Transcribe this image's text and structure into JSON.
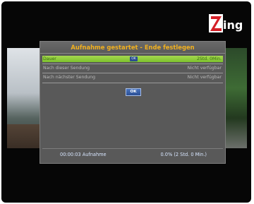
{
  "brand": {
    "logo_text": "Zing",
    "logo_color": "#d41f27"
  },
  "dialog": {
    "title": "Aufnahme gestartet - Ende festlegen",
    "rows": [
      {
        "label": "Dauer",
        "value": "2Std. 0Min.",
        "selected": true,
        "chip": "OK"
      },
      {
        "label": "Nach dieser Sendung",
        "value": "Nicht verfügbar",
        "selected": false
      },
      {
        "label": "Nach nächster Sendung",
        "value": "Nicht verfügbar",
        "selected": false
      }
    ],
    "ok_button": "OK"
  },
  "status": {
    "elapsed": "00:00:03 Aufnahme",
    "progress": "0.0% (2 Std. 0 Min.)",
    "progress_fraction": 0.0
  },
  "colors": {
    "title": "#f2b11f",
    "selection": "#8fce3a",
    "status_text": "#d8e6ff"
  }
}
